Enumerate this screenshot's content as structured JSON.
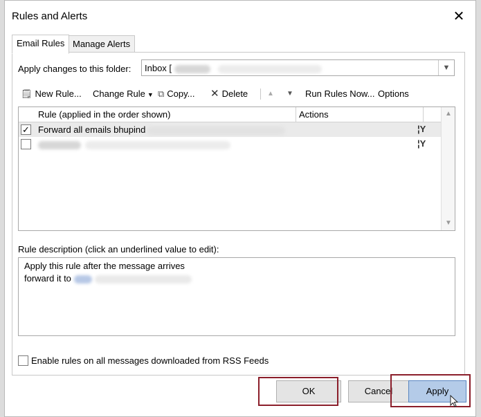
{
  "dialog": {
    "title": "Rules and Alerts",
    "close_glyph": "✕"
  },
  "tabs": [
    {
      "label": "Email Rules",
      "active": true
    },
    {
      "label": "Manage Alerts",
      "active": false
    }
  ],
  "folder": {
    "label": "Apply changes to this folder:",
    "value": "Inbox ["
  },
  "toolbar": {
    "new_rule": "New Rule...",
    "change_rule": "Change Rule",
    "copy": "Copy...",
    "delete": "Delete",
    "run_rules_now": "Run Rules Now...",
    "options": "Options"
  },
  "rules_list": {
    "columns": {
      "rule": "Rule (applied in the order shown)",
      "actions": "Actions"
    },
    "rows": [
      {
        "label": "Forward all emails bhupind",
        "checked": true,
        "selected": true,
        "action_glyph": "¦Y"
      },
      {
        "label": "",
        "checked": false,
        "selected": false,
        "action_glyph": "¦Y"
      }
    ]
  },
  "description": {
    "label": "Rule description (click an underlined value to edit):",
    "line1": "Apply this rule after the message arrives",
    "line2_prefix": "forward it to "
  },
  "rss": {
    "label": "Enable rules on all messages downloaded from RSS Feeds",
    "checked": false
  },
  "buttons": {
    "ok": "OK",
    "cancel": "Cancel",
    "apply": "Apply"
  },
  "colors": {
    "highlight_box": "#8b1e2a",
    "apply_button": "#b4cbe8",
    "link": "#1a5fb4"
  }
}
